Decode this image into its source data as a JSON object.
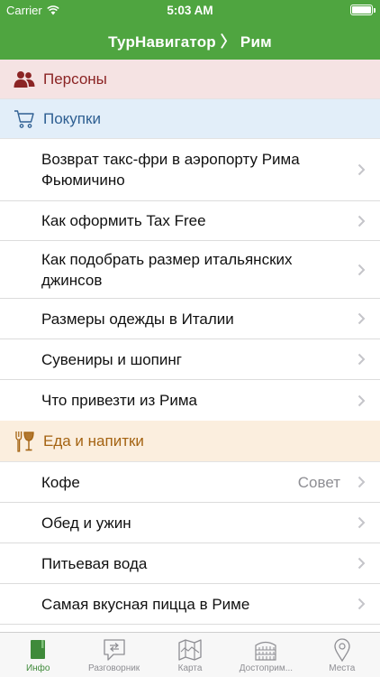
{
  "status": {
    "carrier": "Carrier",
    "time": "5:03 AM"
  },
  "nav": {
    "title": "ТурНавигатор 〉 Рим"
  },
  "sections": {
    "persons": {
      "label": "Персоны",
      "icon": "persons-icon"
    },
    "shopping": {
      "label": "Покупки",
      "icon": "cart-icon"
    },
    "food": {
      "label": "Еда и напитки",
      "icon": "food-drink-icon"
    }
  },
  "shopping_items": [
    {
      "label": "Возврат такс-фри в аэропорту Рима Фьюмичино"
    },
    {
      "label": "Как оформить Tax Free"
    },
    {
      "label": "Как подобрать размер итальянских джинсов"
    },
    {
      "label": "Размеры одежды в Италии"
    },
    {
      "label": "Сувениры и шопинг"
    },
    {
      "label": "Что привезти из Рима"
    }
  ],
  "food_items": [
    {
      "label": "Кофе",
      "detail": "Совет"
    },
    {
      "label": "Обед и ужин"
    },
    {
      "label": "Питьевая вода"
    },
    {
      "label": "Самая вкусная пицца в Риме"
    }
  ],
  "tabbar": {
    "tabs": [
      {
        "label": "Инфо",
        "icon": "book-icon",
        "active": true
      },
      {
        "label": "Разговорник",
        "icon": "phrasebook-icon",
        "active": false
      },
      {
        "label": "Карта",
        "icon": "map-icon",
        "active": false
      },
      {
        "label": "Достоприм...",
        "icon": "landmark-icon",
        "active": false
      },
      {
        "label": "Места",
        "icon": "pin-icon",
        "active": false
      }
    ]
  },
  "colors": {
    "nav_green": "#4fa540",
    "active_tab": "#3f8a3a",
    "persons": "#8b2424",
    "shopping": "#2e5f92",
    "food": "#a46312"
  }
}
